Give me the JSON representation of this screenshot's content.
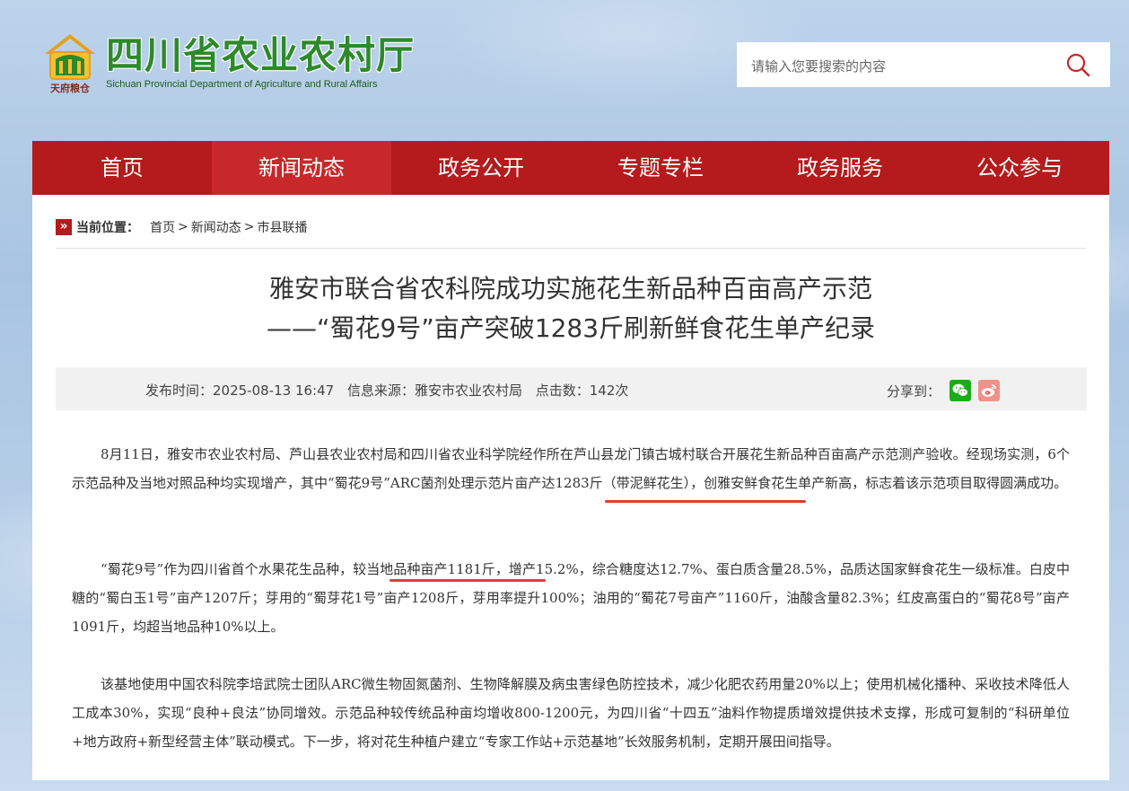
{
  "header": {
    "logo_cn": "四川省农业农村厅",
    "logo_en": "Sichuan Provincial Department of Agriculture and Rural Affairs",
    "emblem_text": "天府粮仓",
    "search_placeholder": "请输入您要搜索的内容"
  },
  "nav": {
    "items": [
      {
        "label": "首页"
      },
      {
        "label": "新闻动态"
      },
      {
        "label": "政务公开"
      },
      {
        "label": "专题专栏"
      },
      {
        "label": "政务服务"
      },
      {
        "label": "公众参与"
      }
    ],
    "active_index": 1
  },
  "breadcrumb": {
    "label": "当前位置：",
    "items": [
      "首页",
      "新闻动态",
      "市县联播"
    ],
    "separator": ">"
  },
  "article": {
    "title_line1": "雅安市联合省农科院成功实施花生新品种百亩高产示范",
    "title_line2": "——“蜀花9号”亩产突破1283斤刷新鲜食花生单产纪录",
    "meta": {
      "publish_time": "发布时间：2025-08-13 16:47",
      "source": "信息来源：雅安市农业农村局",
      "clicks": "点击数：142次",
      "share_label": "分享到："
    },
    "paragraphs": [
      "8月11日，雅安市农业农村局、芦山县农业农村局和四川省农业科学院经作所在芦山县龙门镇古城村联合开展花生新品种百亩高产示范测产验收。经现场实测，6个示范品种及当地对照品种均实现增产，其中“蜀花9号”ARC菌剂处理示范片亩产达1283斤（带泥鲜花生），创雅安鲜食花生单产新高，标志着该示范项目取得圆满成功。",
      "“蜀花9号”作为四川省首个水果花生品种，较当地品种亩产1181斤，增产15.2%，综合糖度达12.7%、蛋白质含量28.5%，品质达国家鲜食花生一级标准。白皮中糖的“蜀白玉1号”亩产1207斤；芽用的“蜀芽花1号”亩产1208斤，芽用率提升100%；油用的“蜀花7号亩产”1160斤，油酸含量82.3%；红皮高蛋白的“蜀花8号”亩产1091斤，均超当地品种10%以上。",
      "该基地使用中国农科院李培武院士团队ARC微生物固氮菌剂、生物降解膜及病虫害绿色防控技术，减少化肥农药用量20%以上；使用机械化播种、采收技术降低人工成本30%，实现“良种+良法”协同增效。示范品种较传统品种亩均增收800-1200元，为四川省“十四五”油料作物提质增效提供技术支撑，形成可复制的“科研单位+地方政府+新型经营主体”联动模式。下一步，将对花生种植户建立“专家工作站+示范基地”长效服务机制，定期开展田间指导。"
    ]
  },
  "colors": {
    "nav_bg": "#b51a1c",
    "nav_active": "#c8282a",
    "logo_green": "#2d8a2a",
    "underline": "#e53935"
  }
}
